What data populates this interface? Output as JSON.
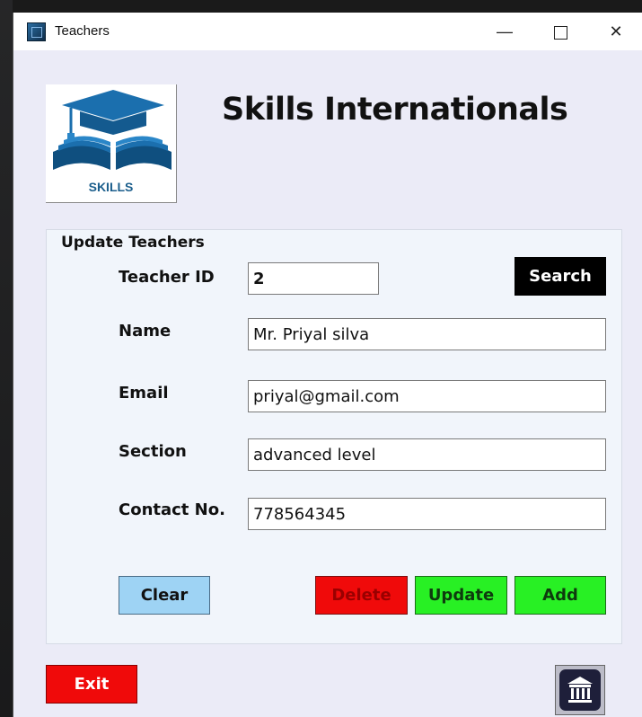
{
  "window": {
    "title": "Teachers",
    "controls": {
      "minimize": "—",
      "close": "✕"
    }
  },
  "header": {
    "logo_text": "SKILLS",
    "company_name": "Skills Internationals"
  },
  "form": {
    "group_title": "Update Teachers",
    "fields": [
      {
        "label": "Teacher ID",
        "value": "2"
      },
      {
        "label": "Name",
        "value": "Mr. Priyal silva"
      },
      {
        "label": "Email",
        "value": "priyal@gmail.com"
      },
      {
        "label": "Section",
        "value": "advanced level"
      },
      {
        "label": "Contact No.",
        "value": "778564345"
      }
    ],
    "buttons": {
      "search": "Search",
      "clear": "Clear",
      "delete": "Delete",
      "update": "Update",
      "add": "Add"
    }
  },
  "footer": {
    "exit": "Exit",
    "home_icon": "bank-building-icon"
  },
  "colors": {
    "window_bg": "#ebebf7",
    "group_bg": "#f1f5fb",
    "search_bg": "#000000",
    "clear_bg": "#9ed3f4",
    "danger_bg": "#f00a0a",
    "success_bg": "#28f024",
    "logo_blue": "#1b5e8c"
  }
}
